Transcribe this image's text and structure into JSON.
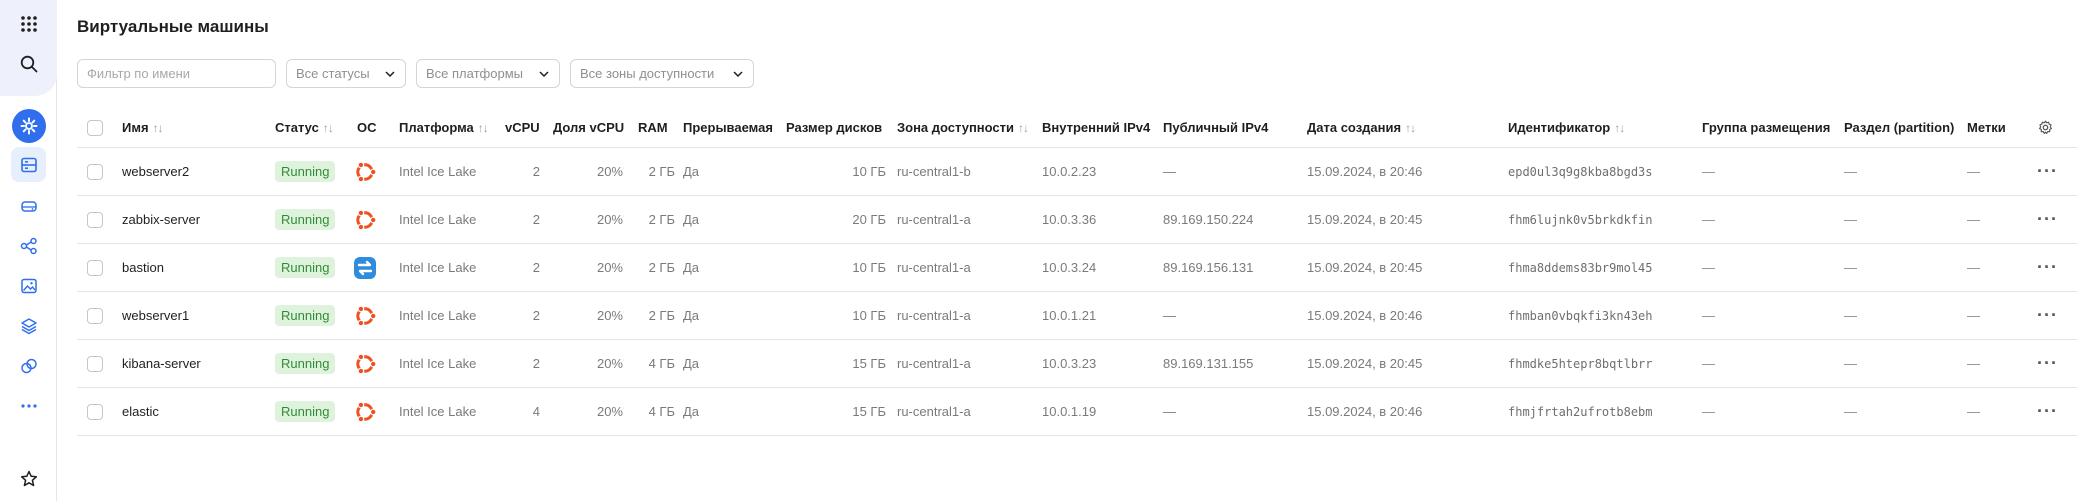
{
  "page": {
    "title": "Виртуальные машины"
  },
  "filters": {
    "name_placeholder": "Фильтр по имени",
    "status_select": "Все статусы",
    "platform_select": "Все платформы",
    "zone_select": "Все зоны доступности"
  },
  "sidebar": {
    "icons": [
      "apps-grid-icon",
      "search-icon",
      "compute-service-icon",
      "vm-list-icon",
      "disk-icon",
      "network-icon",
      "image-icon",
      "layers-icon",
      "snapshot-icon",
      "more-icon",
      "favorites-star-icon"
    ]
  },
  "table": {
    "columns": {
      "name": "Имя",
      "status": "Статус",
      "os": "ОС",
      "platform": "Платформа",
      "vcpu": "vCPU",
      "vcpu_share": "Доля vCPU",
      "ram": "RAM",
      "preemptible": "Прерываемая",
      "disk_size": "Размер дисков",
      "zone": "Зона доступности",
      "internal_ip": "Внутренний IPv4",
      "public_ip": "Публичный IPv4",
      "created": "Дата создания",
      "id": "Идентификатор",
      "placement_group": "Группа размещения",
      "partition": "Раздел (partition)",
      "labels": "Метки"
    },
    "rows": [
      {
        "name": "webserver2",
        "status": "Running",
        "os": "ubuntu",
        "platform": "Intel Ice Lake",
        "vcpu": "2",
        "vcpu_share": "20%",
        "ram": "2 ГБ",
        "preemptible": "Да",
        "disk_size": "10 ГБ",
        "zone": "ru-central1-b",
        "internal_ip": "10.0.2.23",
        "public_ip": "—",
        "created": "15.09.2024, в 20:46",
        "id": "epd0ul3q9g8kba8bgd3s",
        "placement_group": "—",
        "partition": "—",
        "labels": "—"
      },
      {
        "name": "zabbix-server",
        "status": "Running",
        "os": "ubuntu",
        "platform": "Intel Ice Lake",
        "vcpu": "2",
        "vcpu_share": "20%",
        "ram": "2 ГБ",
        "preemptible": "Да",
        "disk_size": "20 ГБ",
        "zone": "ru-central1-a",
        "internal_ip": "10.0.3.36",
        "public_ip": "89.169.150.224",
        "created": "15.09.2024, в 20:45",
        "id": "fhm6lujnk0v5brkdkfin",
        "placement_group": "—",
        "partition": "—",
        "labels": "—"
      },
      {
        "name": "bastion",
        "status": "Running",
        "os": "nat",
        "platform": "Intel Ice Lake",
        "vcpu": "2",
        "vcpu_share": "20%",
        "ram": "2 ГБ",
        "preemptible": "Да",
        "disk_size": "10 ГБ",
        "zone": "ru-central1-a",
        "internal_ip": "10.0.3.24",
        "public_ip": "89.169.156.131",
        "created": "15.09.2024, в 20:45",
        "id": "fhma8ddems83br9mol45",
        "placement_group": "—",
        "partition": "—",
        "labels": "—"
      },
      {
        "name": "webserver1",
        "status": "Running",
        "os": "ubuntu",
        "platform": "Intel Ice Lake",
        "vcpu": "2",
        "vcpu_share": "20%",
        "ram": "2 ГБ",
        "preemptible": "Да",
        "disk_size": "10 ГБ",
        "zone": "ru-central1-a",
        "internal_ip": "10.0.1.21",
        "public_ip": "—",
        "created": "15.09.2024, в 20:46",
        "id": "fhmban0vbqkfi3kn43eh",
        "placement_group": "—",
        "partition": "—",
        "labels": "—"
      },
      {
        "name": "kibana-server",
        "status": "Running",
        "os": "ubuntu",
        "platform": "Intel Ice Lake",
        "vcpu": "2",
        "vcpu_share": "20%",
        "ram": "4 ГБ",
        "preemptible": "Да",
        "disk_size": "15 ГБ",
        "zone": "ru-central1-a",
        "internal_ip": "10.0.3.23",
        "public_ip": "89.169.131.155",
        "created": "15.09.2024, в 20:45",
        "id": "fhmdke5htepr8bqtlbrr",
        "placement_group": "—",
        "partition": "—",
        "labels": "—"
      },
      {
        "name": "elastic",
        "status": "Running",
        "os": "ubuntu",
        "platform": "Intel Ice Lake",
        "vcpu": "4",
        "vcpu_share": "20%",
        "ram": "4 ГБ",
        "preemptible": "Да",
        "disk_size": "15 ГБ",
        "zone": "ru-central1-a",
        "internal_ip": "10.0.1.19",
        "public_ip": "—",
        "created": "15.09.2024, в 20:46",
        "id": "fhmjfrtah2ufrotb8ebm",
        "placement_group": "—",
        "partition": "—",
        "labels": "—"
      }
    ]
  },
  "colors": {
    "accent": "#2f6fed",
    "status_running_bg": "#dff3dc",
    "status_running_text": "#2f8d3a",
    "ubuntu": "#e95420",
    "nat": "#2f8cdc"
  }
}
